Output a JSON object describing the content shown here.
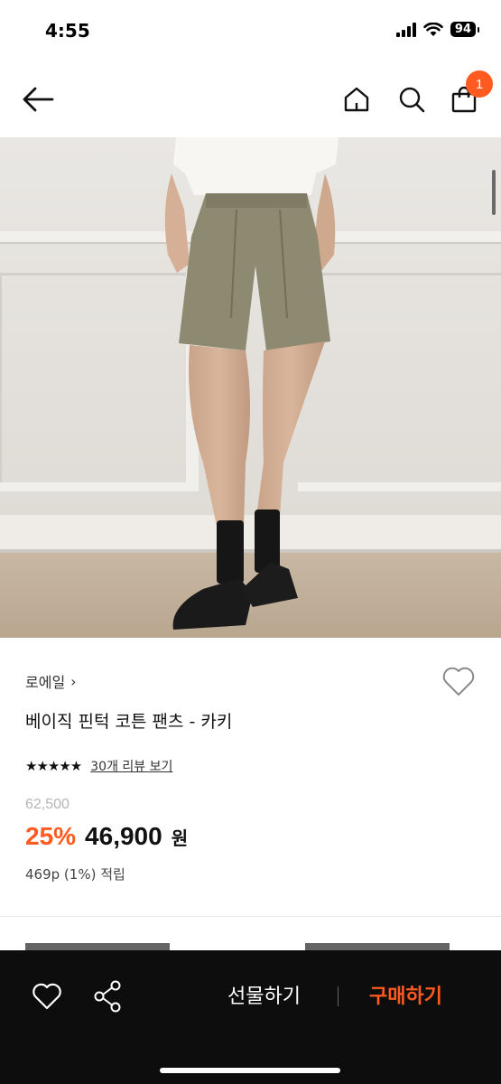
{
  "status_bar": {
    "time": "4:55",
    "battery": "94"
  },
  "header": {
    "cart_count": "1"
  },
  "product": {
    "brand": "로에일",
    "brand_chevron": "›",
    "name": "베이직 핀턱 코튼 팬츠 - 카키",
    "rating_stars": "★★★★★",
    "rating_value": 4.5,
    "review_link": "30개 리뷰 보기",
    "original_price": "62,500",
    "discount": "25%",
    "price": "46,900",
    "currency": "원",
    "points": "469p (1%) 적립"
  },
  "bottom_bar": {
    "gift_label": "선물하기",
    "buy_label": "구매하기"
  },
  "colors": {
    "accent": "#ff5a1f",
    "bottom_bar": "#0d0d0d"
  },
  "icons": [
    "back-arrow-icon",
    "home-icon",
    "search-icon",
    "shopping-bag-icon",
    "heart-icon",
    "share-icon"
  ]
}
